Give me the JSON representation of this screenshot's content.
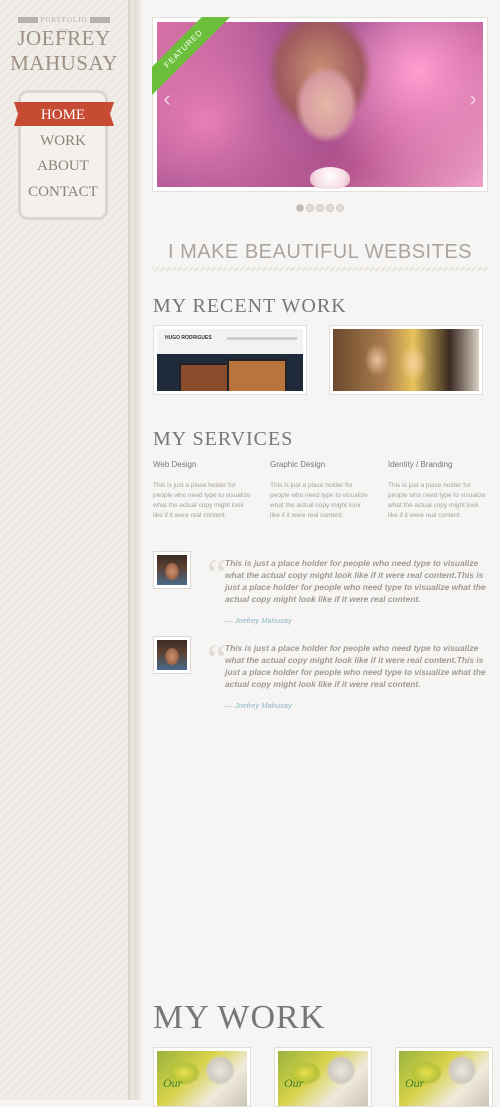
{
  "sidebar": {
    "eyebrow": "PORTFOLIO OF",
    "title_line1": "JOEFREY",
    "title_line2": "MAHUSAY",
    "nav": [
      {
        "label": "HOME",
        "active": true
      },
      {
        "label": "WORK",
        "active": false
      },
      {
        "label": "ABOUT",
        "active": false
      },
      {
        "label": "CONTACT",
        "active": false
      }
    ]
  },
  "slider": {
    "badge": "FEATURED",
    "dot_count": 5,
    "active_dot": 0
  },
  "tagline": "I MAKE BEAUTIFUL WEBSITES",
  "recent_work": {
    "heading": "MY RECENT WORK",
    "thumb1_label": "HUGO RODRIGUES"
  },
  "services": {
    "heading": "MY SERVICES",
    "items": [
      {
        "title": "Web Design",
        "text": "This is just a place holder for people who need type to visualize what the actual copy might look like if it were real content."
      },
      {
        "title": "Graphic Design",
        "text": "This is just a place holder for people who need type to visualize what the actual copy might look like if it were real content."
      },
      {
        "title": "Identity / Branding",
        "text": "This is just a place holder for people who need type to visualize what the actual copy might look like if it were real content."
      }
    ]
  },
  "testimonials": [
    {
      "quote": "This is just a place holder for people who need type to visualize what the actual copy might look like if it were real content.This is just a place holder for people who need type to visualize what the actual copy might look like if it were real content.",
      "author": "— Joefrey Mahusay"
    },
    {
      "quote": "This is just a place holder for people who need type to visualize what the actual copy might look like if it were real content.This is just a place holder for people who need type to visualize what the actual copy might look like if it were real content.",
      "author": "— Joefrey Mahusay"
    }
  ],
  "my_work": {
    "heading": "MY WORK",
    "thumb_word": "Our"
  },
  "colors": {
    "accent_red": "#c74a33",
    "featured_green": "#6cbf3b",
    "author_blue": "#8db6c4"
  }
}
